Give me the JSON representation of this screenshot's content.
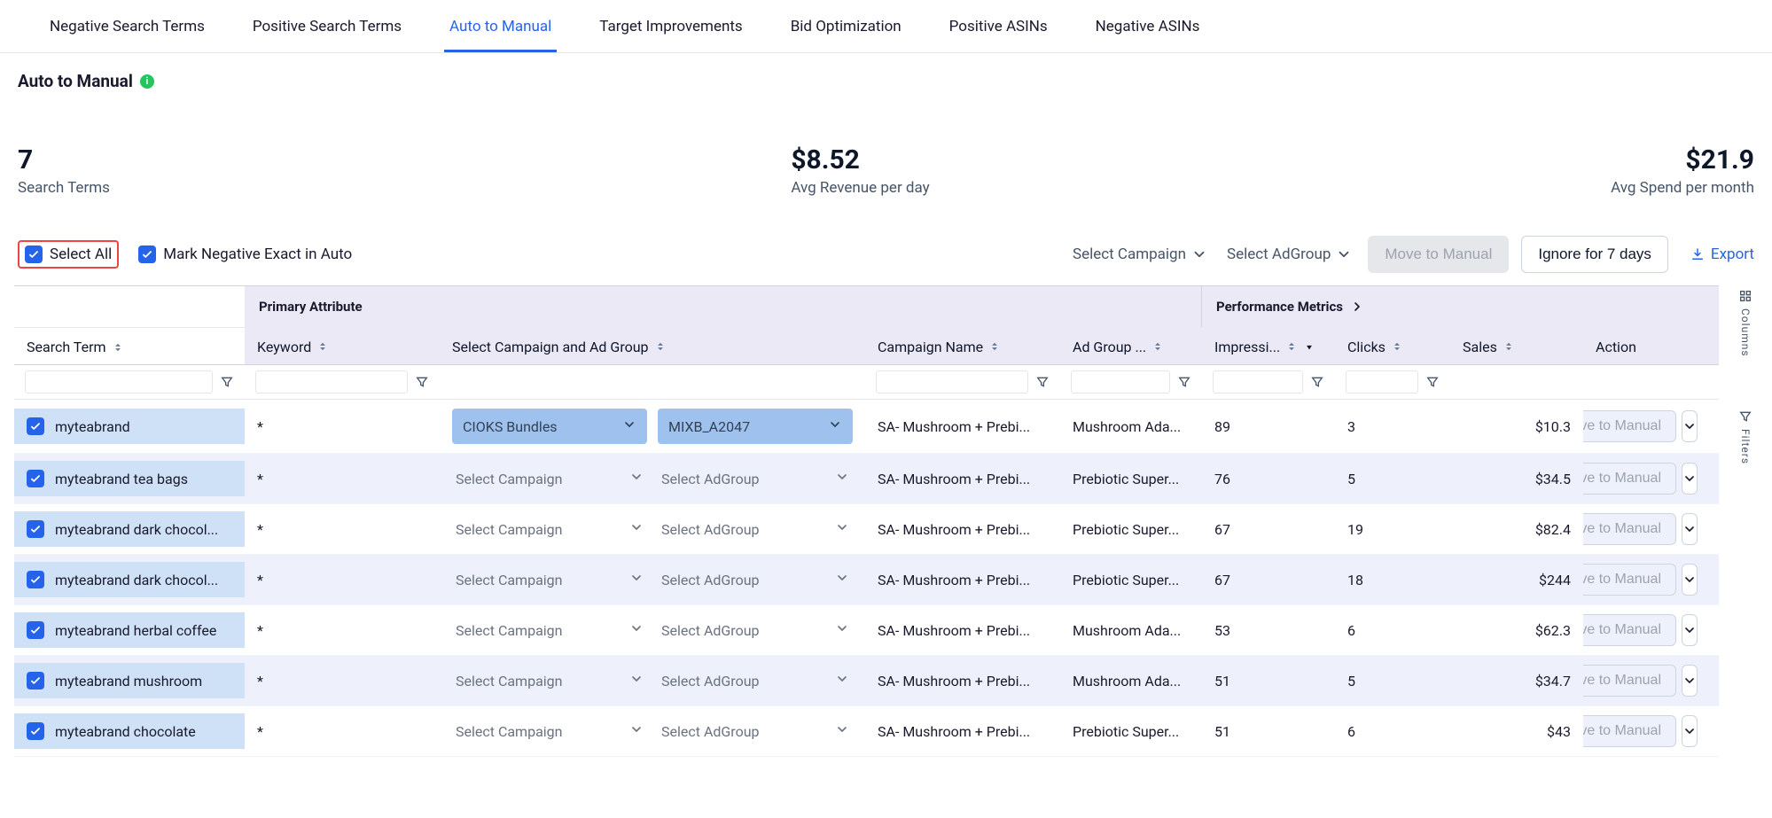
{
  "tabs": [
    {
      "label": "Negative Search Terms"
    },
    {
      "label": "Positive Search Terms"
    },
    {
      "label": "Auto to Manual",
      "active": true
    },
    {
      "label": "Target Improvements"
    },
    {
      "label": "Bid Optimization"
    },
    {
      "label": "Positive ASINs"
    },
    {
      "label": "Negative ASINs"
    }
  ],
  "page": {
    "title": "Auto to Manual",
    "info_icon": "i"
  },
  "stats": {
    "search_terms": {
      "value": "7",
      "label": "Search Terms"
    },
    "avg_rev": {
      "value": "$8.52",
      "label": "Avg Revenue per day"
    },
    "avg_spend": {
      "value": "$21.9",
      "label": "Avg Spend per month"
    }
  },
  "controls": {
    "select_all": "Select All",
    "mark_neg": "Mark Negative Exact in Auto",
    "select_campaign": "Select Campaign",
    "select_adgroup": "Select AdGroup",
    "move_manual": "Move to Manual",
    "ignore": "Ignore for 7 days",
    "export": "Export"
  },
  "table": {
    "group_primary": "Primary Attribute",
    "group_performance": "Performance Metrics",
    "columns": {
      "search_term": "Search Term",
      "keyword": "Keyword",
      "select_cg": "Select Campaign and Ad Group",
      "campaign_name": "Campaign Name",
      "ad_group": "Ad Group ...",
      "impressions": "Impressi...",
      "clicks": "Clicks",
      "sales": "Sales",
      "action": "Action"
    },
    "rows": [
      {
        "term": "myteabrand",
        "kw": "*",
        "campaign_dd": "CIOKS Bundles",
        "adgroup_dd": "MIXB_A2047",
        "boxed": true,
        "campaign_name": "SA- Mushroom + Prebi...",
        "ad_group": "Mushroom Ada...",
        "impressions": "89",
        "clicks": "3",
        "sales": "$10.3",
        "action": "Move to Manual"
      },
      {
        "term": "myteabrand tea bags",
        "kw": "*",
        "campaign_dd": "Select Campaign",
        "adgroup_dd": "Select AdGroup",
        "campaign_name": "SA- Mushroom + Prebi...",
        "ad_group": "Prebiotic Super...",
        "impressions": "76",
        "clicks": "5",
        "sales": "$34.5",
        "action": "Move to Manual"
      },
      {
        "term": "myteabrand dark chocol...",
        "kw": "*",
        "campaign_dd": "Select Campaign",
        "adgroup_dd": "Select AdGroup",
        "campaign_name": "SA- Mushroom + Prebi...",
        "ad_group": "Prebiotic Super...",
        "impressions": "67",
        "clicks": "19",
        "sales": "$82.4",
        "action": "Move to Manual"
      },
      {
        "term": "myteabrand dark chocol...",
        "kw": "*",
        "campaign_dd": "Select Campaign",
        "adgroup_dd": "Select AdGroup",
        "campaign_name": "SA- Mushroom + Prebi...",
        "ad_group": "Prebiotic Super...",
        "impressions": "67",
        "clicks": "18",
        "sales": "$244",
        "action": "Move to Manual"
      },
      {
        "term": "myteabrand herbal coffee",
        "kw": "*",
        "campaign_dd": "Select Campaign",
        "adgroup_dd": "Select AdGroup",
        "campaign_name": "SA- Mushroom + Prebi...",
        "ad_group": "Mushroom Ada...",
        "impressions": "53",
        "clicks": "6",
        "sales": "$62.3",
        "action": "Move to Manual"
      },
      {
        "term": "myteabrand mushroom",
        "kw": "*",
        "campaign_dd": "Select Campaign",
        "adgroup_dd": "Select AdGroup",
        "campaign_name": "SA- Mushroom + Prebi...",
        "ad_group": "Mushroom Ada...",
        "impressions": "51",
        "clicks": "5",
        "sales": "$34.7",
        "action": "Move to Manual"
      },
      {
        "term": "myteabrand chocolate",
        "kw": "*",
        "campaign_dd": "Select Campaign",
        "adgroup_dd": "Select AdGroup",
        "campaign_name": "SA- Mushroom + Prebi...",
        "ad_group": "Prebiotic Super...",
        "impressions": "51",
        "clicks": "6",
        "sales": "$43",
        "action": "Move to Manual"
      }
    ]
  },
  "rails": {
    "columns": "Columns",
    "filters": "Filters"
  }
}
